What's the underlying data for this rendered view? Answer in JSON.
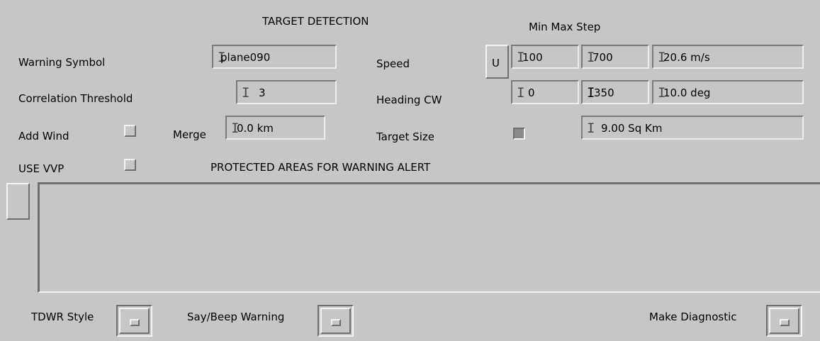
{
  "headers": {
    "target_detection": "TARGET DETECTION",
    "min_max_step": "Min Max Step",
    "protected_areas": "PROTECTED AREAS FOR WARNING ALERT"
  },
  "left": {
    "warning_symbol": {
      "label": "Warning Symbol",
      "value": "plane090"
    },
    "correlation_threshold": {
      "label": "Correlation Threshold",
      "value": "3"
    },
    "add_wind": {
      "label": "Add Wind",
      "checked": false
    },
    "merge": {
      "label": "Merge",
      "value": "0.0 km"
    },
    "use_vvp": {
      "label": "USE VVP",
      "checked": false
    }
  },
  "right": {
    "speed": {
      "label": "Speed",
      "unit_button": "U",
      "min": "100",
      "max": "700",
      "step": "20.6 m/s"
    },
    "heading": {
      "label": "Heading CW",
      "min": "0",
      "max": "350",
      "step": "10.0 deg"
    },
    "target_size": {
      "label": "Target Size",
      "checked": true,
      "value": "9.00 Sq Km"
    }
  },
  "bottom": {
    "tdwr_style": "TDWR Style",
    "say_beep": "Say/Beep Warning",
    "make_diagnostic": "Make Diagnostic"
  },
  "icons": [
    "text-cursor-icon"
  ],
  "colors": {
    "background": "#c6c6c6",
    "shadow": "#6e6e6e",
    "highlight": "#f2f2f2"
  }
}
